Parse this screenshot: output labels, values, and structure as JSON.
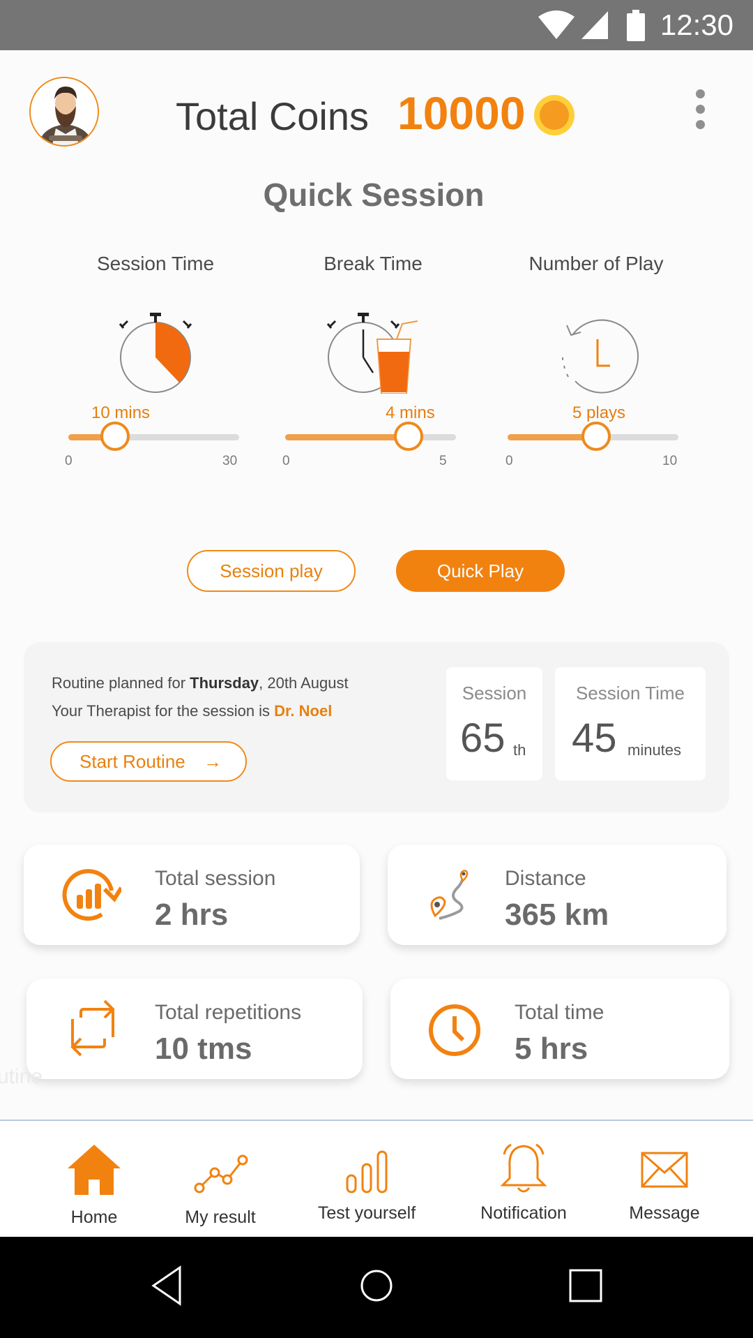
{
  "status_bar": {
    "time": "12:30"
  },
  "header": {
    "coins_label": "Total Coins",
    "coins_value": "10000"
  },
  "quick_session": {
    "title": "Quick Session",
    "sliders": [
      {
        "label": "Session Time",
        "value_text": "10 mins",
        "min": "0",
        "max": "30",
        "value": 10
      },
      {
        "label": "Break Time",
        "value_text": "4 mins",
        "min": "0",
        "max": "5",
        "value": 4
      },
      {
        "label": "Number of Play",
        "value_text": "5 plays",
        "min": "0",
        "max": "10",
        "value": 5
      }
    ],
    "buttons": {
      "session_play": "Session play",
      "quick_play": "Quick Play"
    }
  },
  "routine": {
    "planned_prefix": "Routine planned for ",
    "planned_day": "Thursday",
    "planned_date": ", 20th August",
    "therapist_prefix": "Your Therapist for the session is ",
    "therapist_name": "Dr. Noel",
    "start_label": "Start Routine",
    "session": {
      "caption": "Session",
      "value": "65",
      "suffix": "th"
    },
    "session_time": {
      "caption": "Session Time",
      "value": "45",
      "unit": "minutes"
    }
  },
  "stats": {
    "total_session": {
      "caption": "Total session",
      "value": "2 hrs"
    },
    "distance": {
      "caption": "Distance",
      "value": "365 km"
    },
    "total_repetitions": {
      "caption": "Total repetitions",
      "value": "10 tms"
    },
    "total_time": {
      "caption": "Total time",
      "value": "5 hrs"
    }
  },
  "ghost_text": "utine",
  "bottom_nav": {
    "home": "Home",
    "my_result": "My result",
    "test_yourself": "Test yourself",
    "notification": "Notification",
    "message": "Message",
    "active": "home"
  },
  "colors": {
    "accent": "#f2820f",
    "coin": "#ffcf3a",
    "status_bar": "#757575"
  }
}
